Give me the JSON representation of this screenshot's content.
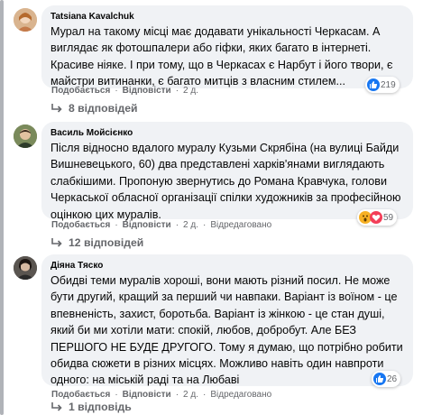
{
  "comments": [
    {
      "author": "Tatsiana Kavalchuk",
      "lines": [
        "Мурал на такому місці має додавати унікальності Черкасам. А",
        "виглядає як фотошпалери або гіфки, яких багато в інтернеті.",
        "Красиве ніяке. І при тому, що в Черкасах є Нарбут і його твори, є",
        "майстри витинанки, є багато митців з власним стилем..."
      ],
      "like_label": "Подобається",
      "reply_label": "Відповісти",
      "time": "2 д.",
      "reaction_count": "219",
      "replies_label": "8 відповідей"
    },
    {
      "author": "Василь Мойсієнко",
      "lines": [
        "Після відносно вдалого муралу Кузьми Скрябіна (на вулиці Байди",
        "Вишневецького, 60) два представлені харків'янами виглядають",
        "слабкішими. Пропоную звернутись до Романа Кравчука, голови",
        "Черкаської обласної організації спілки художників за професійною",
        "оцінкою цих муралів."
      ],
      "like_label": "Подобається",
      "reply_label": "Відповісти",
      "time": "2 д.",
      "edited_label": "Відредаговано",
      "reaction_count": "59",
      "replies_label": "12 відповідей"
    },
    {
      "author": "Діяна Тяско",
      "lines": [
        "Обидві теми муралів хороші, вони мають різний посил. Не може",
        "бути другий, кращий за перший чи навпаки. Варіант із воїном - це",
        "впевненість, захист, боротьба. Варіант із жінкою - це стан душі,",
        "який би ми хотіли мати: спокій, любов, добробут. Але БЕЗ",
        "ПЕРШОГО НЕ БУДЕ ДРУГОГО. Тому я думаю, що потрібно робити",
        "обидва сюжети в різних місцях. Можливо навіть один навпроти",
        "одного: на міській раді та на Любаві"
      ],
      "like_label": "Подобається",
      "reply_label": "Відповісти",
      "time": "2 д.",
      "edited_label": "Відредаговано",
      "reaction_count": "26",
      "replies_label": "1 відповідь"
    }
  ],
  "colors": {
    "like_blue": "#1877f2",
    "wow_yellow": "#f7b125",
    "heart_red": "#f33e58",
    "bubble_bg": "#f0f2f5",
    "meta_gray": "#65676b"
  }
}
